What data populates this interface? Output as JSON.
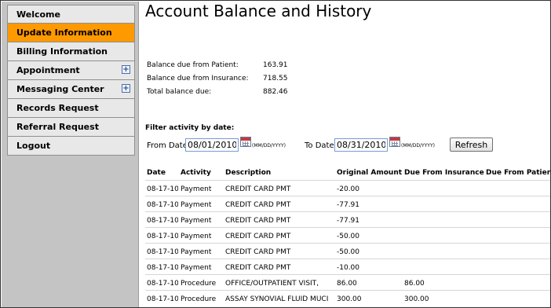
{
  "sidebar": {
    "items": [
      {
        "label": "Welcome",
        "active": false,
        "expandable": false
      },
      {
        "label": "Update Information",
        "active": true,
        "expandable": false
      },
      {
        "label": "Billing Information",
        "active": false,
        "expandable": false
      },
      {
        "label": "Appointment",
        "active": false,
        "expandable": true
      },
      {
        "label": "Messaging Center",
        "active": false,
        "expandable": true
      },
      {
        "label": "Records Request",
        "active": false,
        "expandable": false
      },
      {
        "label": "Referral Request",
        "active": false,
        "expandable": false
      },
      {
        "label": "Logout",
        "active": false,
        "expandable": false
      }
    ],
    "expand_glyph": "+",
    "active_color": "#ff9900"
  },
  "main": {
    "title": "Account Balance and History",
    "balances": [
      {
        "label": "Balance due from Patient:",
        "value": "163.91"
      },
      {
        "label": "Balance due from Insurance:",
        "value": "718.55"
      },
      {
        "label": "Total balance due:",
        "value": "882.46"
      }
    ],
    "filter": {
      "title": "Filter activity by date:",
      "from_label": "From Date:",
      "from_value": "08/01/2010",
      "to_label": "To Date:",
      "to_value": "08/31/2010",
      "format_hint": "(MM/DD/YYYY)",
      "refresh_label": "Refresh"
    },
    "table": {
      "headers": [
        "Date",
        "Activity",
        "Description",
        "Original Amount",
        "Due From Insurance",
        "Due From Patient"
      ],
      "rows": [
        [
          "08-17-10",
          "Payment",
          "CREDIT CARD PMT",
          "-20.00",
          "",
          ""
        ],
        [
          "08-17-10",
          "Payment",
          "CREDIT CARD PMT",
          "-77.91",
          "",
          ""
        ],
        [
          "08-17-10",
          "Payment",
          "CREDIT CARD PMT",
          "-77.91",
          "",
          ""
        ],
        [
          "08-17-10",
          "Payment",
          "CREDIT CARD PMT",
          "-50.00",
          "",
          ""
        ],
        [
          "08-17-10",
          "Payment",
          "CREDIT CARD PMT",
          "-50.00",
          "",
          ""
        ],
        [
          "08-17-10",
          "Payment",
          "CREDIT CARD PMT",
          "-10.00",
          "",
          ""
        ],
        [
          "08-17-10",
          "Procedure",
          "OFFICE/OUTPATIENT VISIT,",
          "86.00",
          "86.00",
          ""
        ],
        [
          "08-17-10",
          "Procedure",
          "ASSAY SYNOVIAL FLUID MUCI",
          "300.00",
          "300.00",
          ""
        ]
      ]
    }
  }
}
